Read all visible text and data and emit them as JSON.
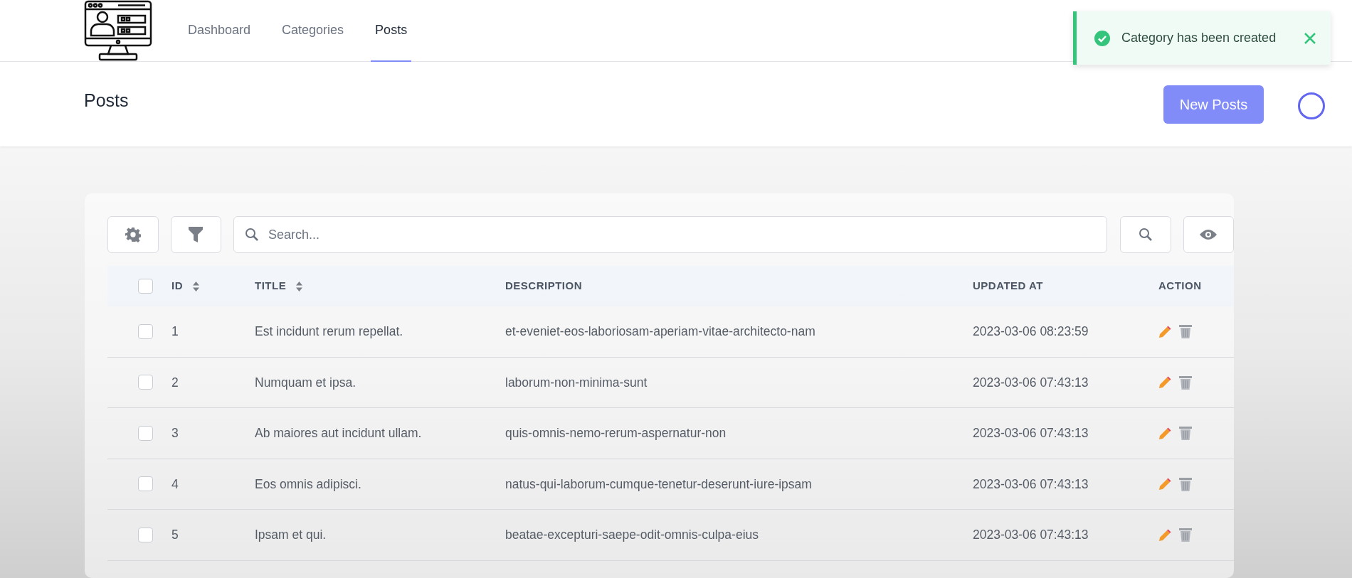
{
  "navbar": {
    "links": [
      {
        "label": "Dashboard",
        "selected": false
      },
      {
        "label": "Categories",
        "selected": false
      },
      {
        "label": "Posts",
        "selected": true
      }
    ]
  },
  "toast": {
    "kind": "success",
    "message": "Category has been created"
  },
  "header": {
    "title": "Posts",
    "button": "New Posts"
  },
  "toolbar": {
    "search": {
      "placeholder": "Search..."
    }
  },
  "table": {
    "select_all": {
      "checked": false
    },
    "columns": [
      {
        "label": "ID",
        "sortable": true
      },
      {
        "label": "TITLE",
        "sortable": true
      },
      {
        "label": "DESCRIPTION",
        "sortable": false
      },
      {
        "label": "UPDATED AT",
        "sortable": false
      },
      {
        "label": "ACTION",
        "sortable": false
      }
    ],
    "rows": [
      {
        "checked": false,
        "cells": [
          "1",
          "Est incidunt rerum repellat.",
          "et-eveniet-eos-laboriosam-aperiam-vitae-architecto-nam",
          "2023-03-06 08:23:59"
        ]
      },
      {
        "checked": false,
        "cells": [
          "2",
          "Numquam et ipsa.",
          "laborum-non-minima-sunt",
          "2023-03-06 07:43:13"
        ]
      },
      {
        "checked": false,
        "cells": [
          "3",
          "Ab maiores aut incidunt ullam.",
          "quis-omnis-nemo-rerum-aspernatur-non",
          "2023-03-06 07:43:13"
        ]
      },
      {
        "checked": false,
        "cells": [
          "4",
          "Eos omnis adipisci.",
          "natus-qui-laborum-cumque-tenetur-deserunt-iure-ipsam",
          "2023-03-06 07:43:13"
        ]
      },
      {
        "checked": false,
        "cells": [
          "5",
          "Ipsam et qui.",
          "beatae-excepturi-saepe-odit-omnis-culpa-eius",
          "2023-03-06 07:43:13"
        ]
      }
    ]
  }
}
